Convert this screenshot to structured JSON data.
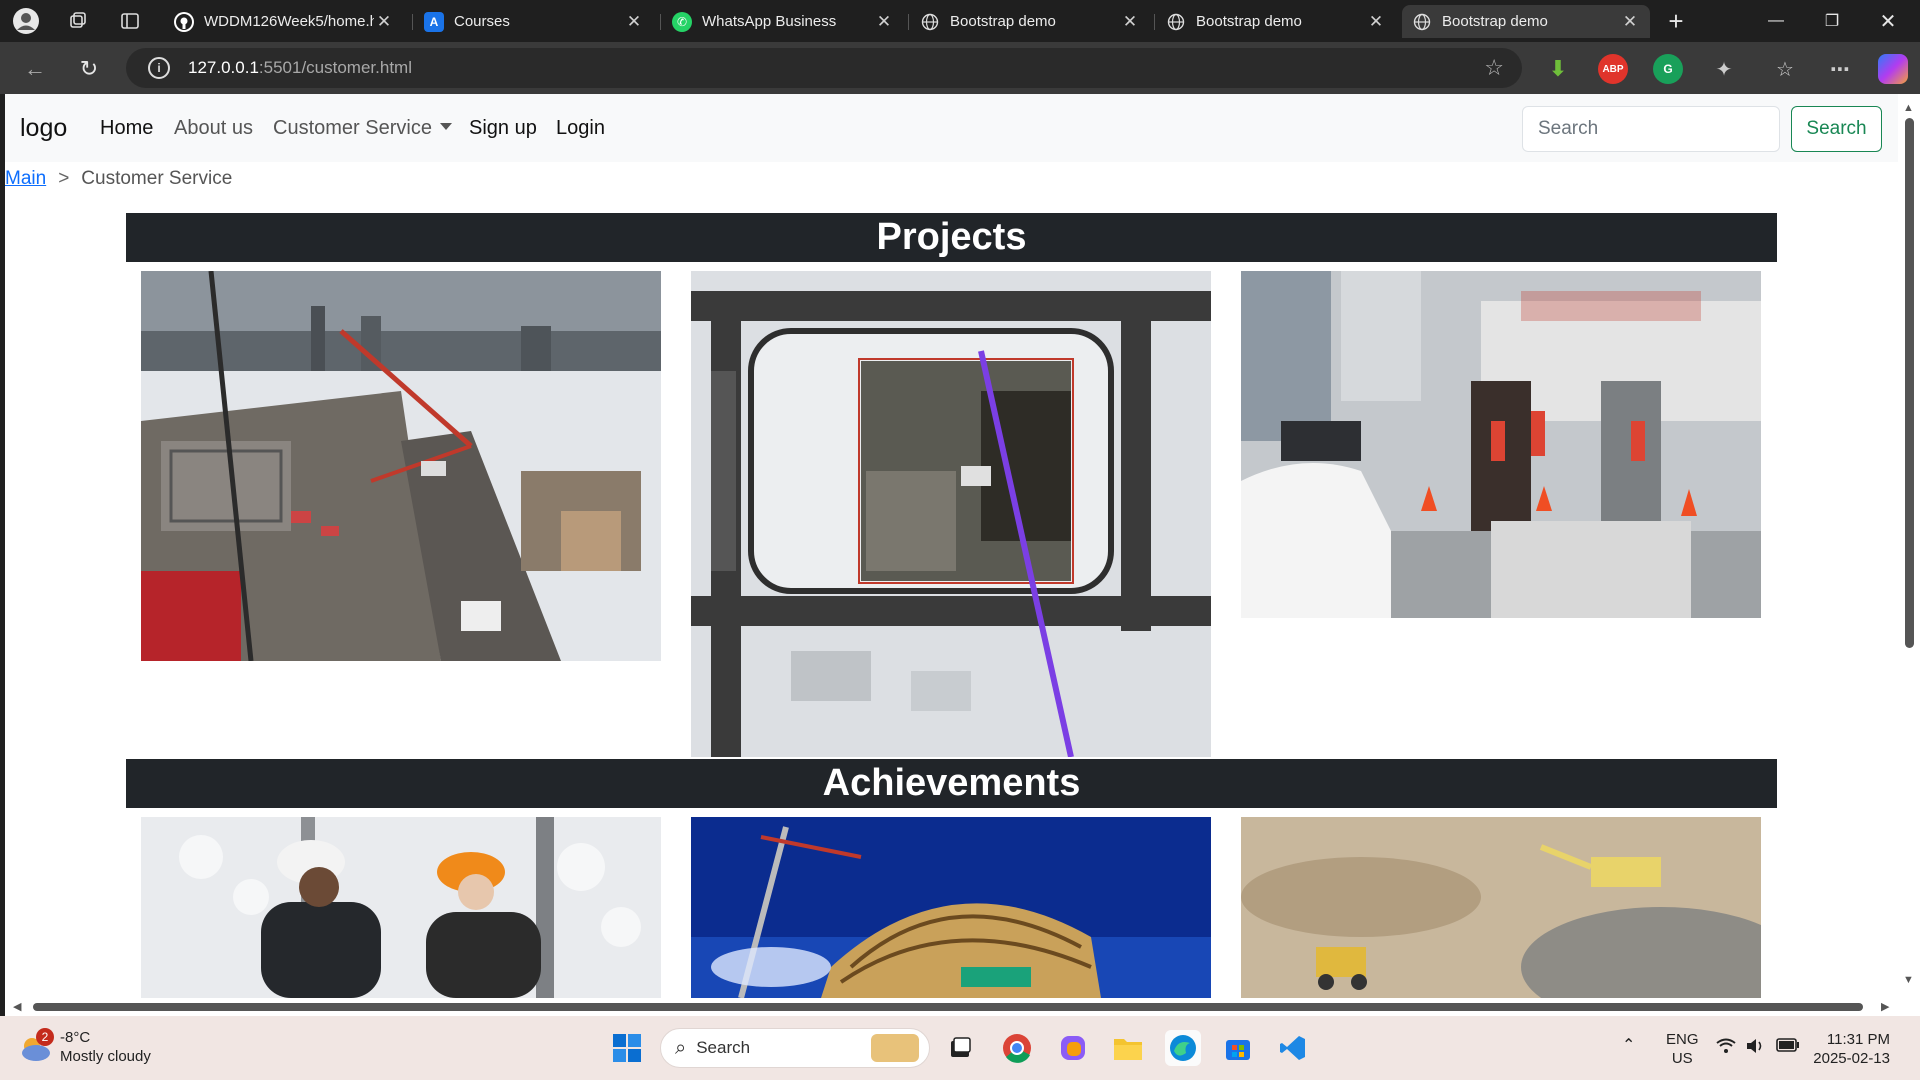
{
  "browser": {
    "tabs": [
      {
        "title": "WDDM126Week5/home.h",
        "icon": "github-icon",
        "active": false
      },
      {
        "title": "Courses",
        "icon": "brightspace-icon",
        "active": false
      },
      {
        "title": "WhatsApp Business",
        "icon": "whatsapp-icon",
        "active": false
      },
      {
        "title": "Bootstrap demo",
        "icon": "globe-icon",
        "active": false
      },
      {
        "title": "Bootstrap demo",
        "icon": "globe-icon",
        "active": false
      },
      {
        "title": "Bootstrap demo",
        "icon": "globe-icon",
        "active": true
      }
    ],
    "url_host": "127.0.0.1",
    "url_rest": ":5501/customer.html",
    "extensions": {
      "abp_label": "ABP"
    }
  },
  "navbar": {
    "brand": "logo",
    "links": {
      "home": "Home",
      "about": "About us",
      "customer_service": "Customer Service",
      "signup": "Sign up",
      "login": "Login"
    },
    "search_placeholder": "Search",
    "search_button": "Search"
  },
  "breadcrumb": {
    "main": "Main",
    "separator": ">",
    "current": "Customer Service"
  },
  "sections": {
    "projects": "Projects",
    "achievements": "Achievements"
  },
  "colors": {
    "section_bar": "#212529",
    "search_button": "#198754",
    "link": "#0d6efd"
  },
  "taskbar": {
    "weather_badge": "2",
    "temperature": "-8°C",
    "condition": "Mostly cloudy",
    "search_label": "Search",
    "language": "ENG",
    "region": "US",
    "time": "11:31 PM",
    "date": "2025-02-13"
  }
}
